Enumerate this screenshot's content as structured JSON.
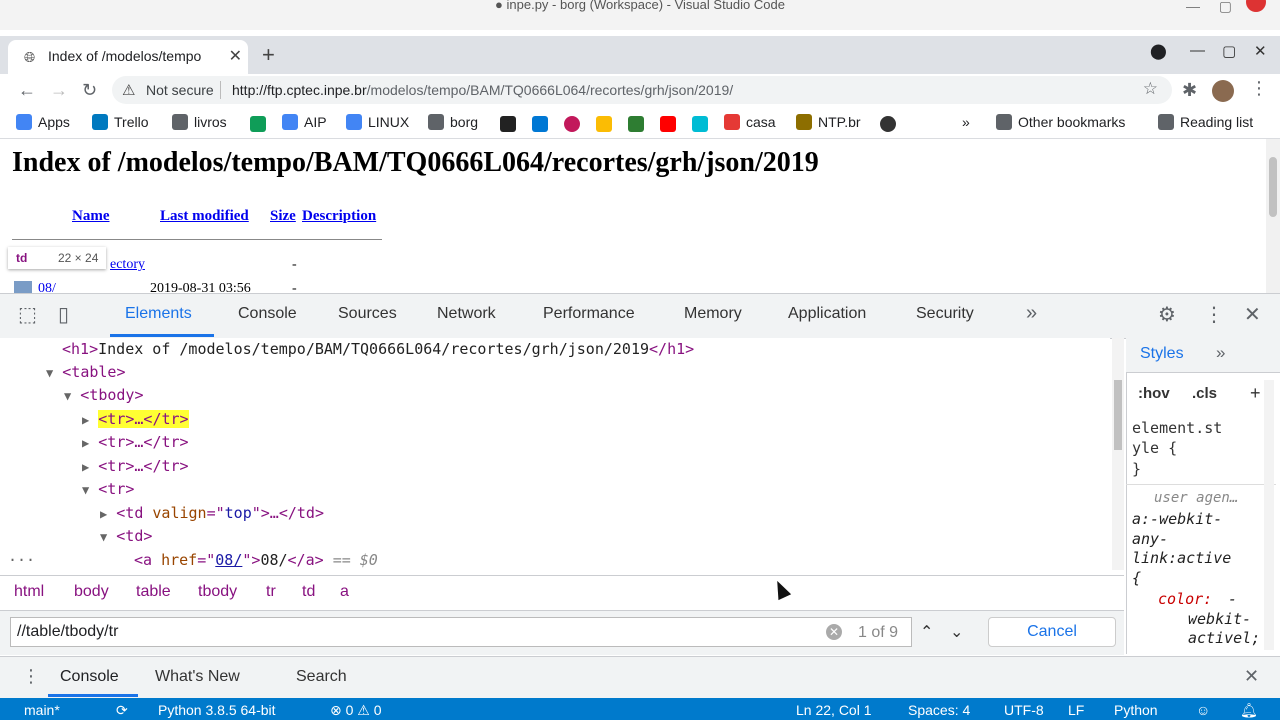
{
  "vscode": {
    "window_title": "● inpe.py - borg (Workspace) - Visual Studio Code"
  },
  "browser": {
    "tab": {
      "title": "Index of /modelos/tempo"
    },
    "address_bar": {
      "security": "Not secure",
      "url_host": "http://ftp.cptec.inpe.br",
      "url_path": "/modelos/tempo/BAM/TQ0666L064/recortes/grh/json/2019/"
    },
    "bookmarks": [
      {
        "label": "Apps",
        "icon": "apps-grid-icon",
        "color": "#4285f4"
      },
      {
        "label": "Trello",
        "icon": "trello-icon",
        "color": "#0079bf"
      },
      {
        "label": "livros",
        "icon": "folder-icon",
        "color": "#5f6368"
      },
      {
        "label": "AIP",
        "icon": "doc-icon",
        "color": "#4285f4"
      },
      {
        "label": "LINUX",
        "icon": "doc-icon",
        "color": "#4285f4"
      },
      {
        "label": "borg",
        "icon": "folder-icon",
        "color": "#5f6368"
      },
      {
        "label": "casa",
        "icon": "casa-icon",
        "color": "#e53935"
      },
      {
        "label": "NTP.br",
        "icon": "ntp-icon",
        "color": "#8d6e00"
      }
    ],
    "other_bookmarks": "Other bookmarks",
    "reading_list": "Reading list"
  },
  "page": {
    "heading": "Index of /modelos/tempo/BAM/TQ0666L064/recortes/grh/json/2019",
    "columns": [
      "Name",
      "Last modified",
      "Size",
      "Description"
    ],
    "rows": [
      {
        "name": "Parent Directory",
        "name_visible": "ectory",
        "modified": "",
        "size": "-"
      },
      {
        "name": "08/",
        "modified": "2019-08-31 03:56",
        "size": "-"
      }
    ],
    "tooltip": {
      "tag": "td",
      "size": "22 × 24"
    }
  },
  "devtools": {
    "tabs": [
      "Elements",
      "Console",
      "Sources",
      "Network",
      "Performance",
      "Memory",
      "Application",
      "Security"
    ],
    "active_tab": "Elements",
    "dom": {
      "h1_text": "Index of /modelos/tempo/BAM/TQ0666L064/recortes/grh/json/2019",
      "td_valign_value": "top",
      "a_href": "08/",
      "a_text": "08/",
      "selected_marker": "== $0"
    },
    "breadcrumbs": [
      "html",
      "body",
      "table",
      "tbody",
      "tr",
      "td",
      "a"
    ],
    "search": {
      "value": "//table/tbody/tr",
      "match_count": "1 of 9",
      "cancel_label": "Cancel"
    },
    "styles": {
      "tab": "Styles",
      "hov": ":hov",
      "cls": ".cls",
      "element_style_1": "element.st",
      "element_style_2": "yle {",
      "close_brace": "}",
      "user_agent": "user agen…",
      "rule_1": "a:-webkit-",
      "rule_2": "any-",
      "rule_3": "link:active",
      "rule_4": "{",
      "prop": "color:",
      "val_1": "-",
      "val_2": "webkit-",
      "val_3": "activel;"
    },
    "drawer_tabs": [
      "Console",
      "What's New",
      "Search"
    ]
  },
  "statusbar": {
    "branch": "main*",
    "python": "Python 3.8.5 64-bit",
    "problems": "⊗ 0 ⚠ 0",
    "position": "Ln 22, Col 1",
    "spaces": "Spaces: 4",
    "encoding": "UTF-8",
    "eol": "LF",
    "language": "Python",
    "color": "#007acc"
  }
}
